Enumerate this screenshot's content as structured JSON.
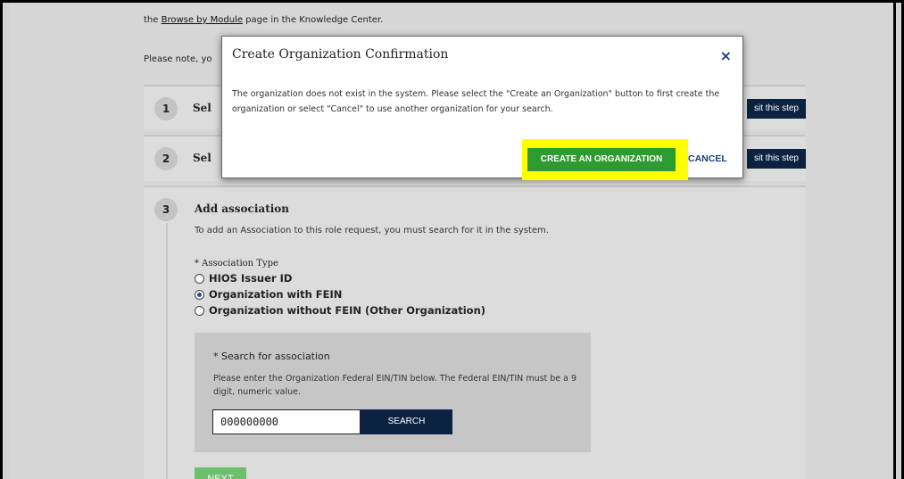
{
  "page": {
    "intro_prefix": "the ",
    "intro_link": "Browse by Module",
    "intro_suffix": " page in the Knowledge Center.",
    "note_text": "Please note, yo"
  },
  "steps": [
    {
      "number": "1",
      "label": "Sel",
      "revisit_label": "sit this step"
    },
    {
      "number": "2",
      "label": "Sel",
      "revisit_label": "sit this step"
    }
  ],
  "step3": {
    "number": "3",
    "title": "Add association",
    "description": "To add an Association to this role request, you must search for it in the system.",
    "association_type_label": "* Association Type",
    "options": [
      {
        "label": "HIOS Issuer ID",
        "checked": false
      },
      {
        "label": "Organization with FEIN",
        "checked": true
      },
      {
        "label": "Organization without FEIN (Other Organization)",
        "checked": false
      }
    ],
    "search": {
      "label": "* Search for association",
      "help": "Please enter the Organization Federal EIN/TIN below. The Federal EIN/TIN must be a 9 digit, numeric value.",
      "value": "000000000",
      "button_label": "SEARCH"
    },
    "next_label": "NEXT"
  },
  "modal": {
    "title": "Create Organization Confirmation",
    "close_icon": "×",
    "body": "The organization does not exist in the system. Please select the \"Create an Organization\" button to first create the organization or select \"Cancel\" to use another organization for your search.",
    "create_label": "CREATE AN ORGANIZATION",
    "cancel_label": "CANCEL"
  },
  "colors": {
    "navy": "#0b2340",
    "create_green": "#2e9b2e",
    "highlight": "#ffff00",
    "next_green": "#6cbf6c"
  }
}
